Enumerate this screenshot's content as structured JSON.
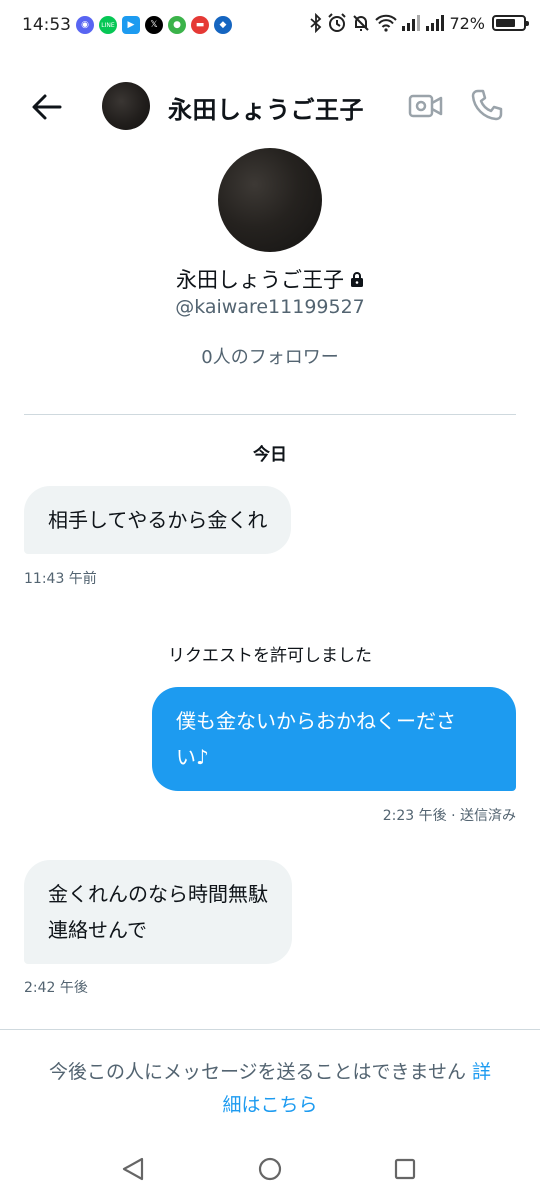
{
  "status_bar": {
    "time": "14:53",
    "battery": "72%",
    "battery_level": 0.72,
    "apps": [
      {
        "icon": "discord-icon",
        "color": "#5865f2"
      },
      {
        "icon": "line-icon",
        "color": "#06c755"
      },
      {
        "icon": "video-app-icon",
        "color": "#1d9bf0"
      },
      {
        "icon": "x-icon",
        "color": "#000000"
      },
      {
        "icon": "frog-app-icon",
        "color": "#3bb34a"
      },
      {
        "icon": "red-app-icon",
        "color": "#e53935"
      },
      {
        "icon": "blue-app-icon",
        "color": "#1565c0"
      }
    ]
  },
  "header": {
    "title": "永田しょうご王子"
  },
  "profile": {
    "name": "永田しょうご王子",
    "handle": "@kaiware11199527",
    "followers": "0人のフォロワー"
  },
  "conversation": {
    "day_label": "今日",
    "messages": [
      {
        "direction": "in",
        "text": "相手してやるから金くれ",
        "timestamp": "11:43 午前"
      },
      {
        "direction": "system",
        "text": "リクエストを許可しました"
      },
      {
        "direction": "out",
        "lines": [
          "僕も金ないからおかねくーださ",
          "い♪"
        ],
        "timestamp": "2:23 午後 · 送信済み"
      },
      {
        "direction": "in",
        "lines": [
          "金くれんのなら時間無駄",
          "連絡せんで"
        ],
        "timestamp": "2:42 午後"
      }
    ]
  },
  "footer": {
    "notice": "今後この人にメッセージを送ることはできません",
    "link_part1": "詳",
    "link_part2": "細はこちら"
  },
  "colors": {
    "accent": "#1d9bf0",
    "incoming_bubble": "#eff3f4",
    "secondary_text": "#536471"
  }
}
